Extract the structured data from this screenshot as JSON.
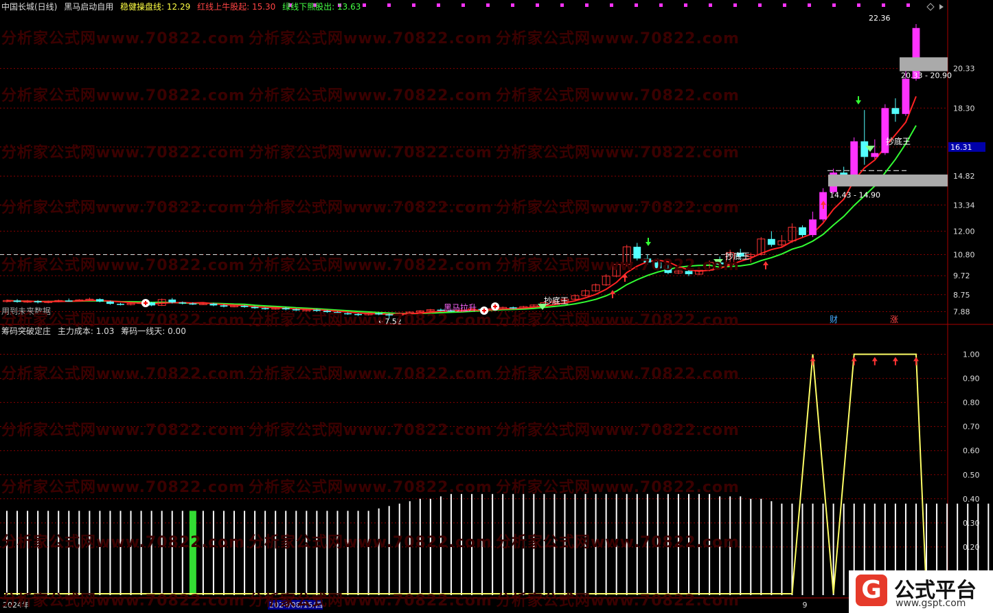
{
  "header": {
    "title": "中国长城(日线)",
    "indicator_name": "黑马启动自用",
    "line1_label": "稳健操盘线: 12.29",
    "line2_label": "红线上牛股起: 15.30",
    "line3_label": "绿线下熊股出: 13.63"
  },
  "sub_header": {
    "indicator_name": "筹码突破定庄",
    "value1": "主力成本: 1.03",
    "value2": "筹码一线天: 0.00"
  },
  "watermark": "分析家公式网www.70822.com",
  "logo": {
    "brand": "公式平台",
    "url": "www.gspt.com",
    "glyph": "G"
  },
  "annotations": {
    "future_data": "用到未来数据",
    "low_price": "←7.52",
    "high_price": "22.36",
    "zone_top": "20.33 - 20.90",
    "zone_bottom": "14.43 - 14.90",
    "bottom_king": "抄底王",
    "black_horse": "黑马拉升",
    "current_price": "16.31",
    "finance_tag": "财",
    "up_tag": "涨"
  },
  "colors": {
    "background": "#000000",
    "up_candle": "#ff3333",
    "down_candle": "#54ffff",
    "magenta": "#ff33ff",
    "red_line": "#ff2222",
    "green_line": "#33ff33",
    "yellow_line": "#ffff66",
    "grid": "#8b0000",
    "axis_text": "#dddddd"
  },
  "chart_data": [
    {
      "type": "candlestick",
      "title": "中国长城(日线)",
      "y_ticks": [
        "20.33",
        "18.30",
        "16.31",
        "14.82",
        "13.34",
        "12.00",
        "10.80",
        "9.72",
        "8.75",
        "7.88"
      ],
      "x_ticks": [
        "2024年",
        "8",
        "2024/08/15/四",
        "9",
        "10"
      ],
      "ylim": [
        7.3,
        23.2
      ],
      "candles": [
        [
          8.4,
          8.45,
          8.5,
          8.35
        ],
        [
          8.45,
          8.38,
          8.52,
          8.34
        ],
        [
          8.38,
          8.42,
          8.48,
          8.33
        ],
        [
          8.42,
          8.36,
          8.47,
          8.3
        ],
        [
          8.36,
          8.4,
          8.45,
          8.31
        ],
        [
          8.4,
          8.45,
          8.5,
          8.36
        ],
        [
          8.45,
          8.43,
          8.55,
          8.39
        ],
        [
          8.43,
          8.48,
          8.52,
          8.4
        ],
        [
          8.48,
          8.52,
          8.6,
          8.44
        ],
        [
          8.52,
          8.4,
          8.56,
          8.36
        ],
        [
          8.4,
          8.28,
          8.44,
          8.24
        ],
        [
          8.28,
          8.24,
          8.33,
          8.2
        ],
        [
          8.24,
          8.3,
          8.35,
          8.2
        ],
        [
          8.3,
          8.35,
          8.4,
          8.26
        ],
        [
          8.35,
          8.2,
          8.38,
          8.16
        ],
        [
          8.2,
          8.5,
          8.55,
          8.17
        ],
        [
          8.5,
          8.35,
          8.58,
          8.3
        ],
        [
          8.35,
          8.3,
          8.4,
          8.25
        ],
        [
          8.3,
          8.26,
          8.36,
          8.22
        ],
        [
          8.26,
          8.29,
          8.34,
          8.22
        ],
        [
          8.29,
          8.2,
          8.33,
          8.16
        ],
        [
          8.2,
          8.14,
          8.25,
          8.1
        ],
        [
          8.14,
          8.18,
          8.22,
          8.1
        ],
        [
          8.18,
          8.12,
          8.22,
          8.08
        ],
        [
          8.12,
          8.06,
          8.16,
          8.02
        ],
        [
          8.06,
          8.02,
          8.1,
          7.98
        ],
        [
          8.02,
          8.06,
          8.1,
          7.98
        ],
        [
          8.06,
          8.0,
          8.12,
          7.95
        ],
        [
          8.0,
          7.96,
          8.04,
          7.92
        ],
        [
          7.96,
          7.98,
          8.03,
          7.92
        ],
        [
          7.98,
          7.92,
          8.02,
          7.88
        ],
        [
          7.92,
          7.86,
          7.96,
          7.82
        ],
        [
          7.86,
          7.8,
          7.9,
          7.76
        ],
        [
          7.8,
          7.76,
          7.84,
          7.72
        ],
        [
          7.76,
          7.72,
          7.8,
          7.66
        ],
        [
          7.72,
          7.8,
          7.85,
          7.68
        ],
        [
          7.8,
          7.74,
          7.84,
          7.7
        ],
        [
          7.74,
          7.7,
          7.78,
          7.52
        ],
        [
          7.7,
          7.8,
          7.84,
          7.66
        ],
        [
          7.8,
          7.86,
          7.9,
          7.76
        ],
        [
          7.86,
          7.92,
          7.96,
          7.82
        ],
        [
          7.92,
          7.98,
          8.02,
          7.88
        ],
        [
          7.98,
          7.94,
          8.04,
          7.9
        ],
        [
          7.94,
          7.9,
          7.98,
          7.86
        ],
        [
          7.9,
          7.96,
          8.0,
          7.86
        ],
        [
          7.96,
          8.02,
          8.06,
          7.92
        ],
        [
          8.02,
          7.98,
          8.06,
          7.94
        ],
        [
          7.98,
          8.04,
          8.08,
          7.94
        ],
        [
          8.04,
          8.1,
          8.14,
          8.0
        ],
        [
          8.1,
          8.06,
          8.14,
          8.02
        ],
        [
          8.06,
          8.14,
          8.18,
          8.02
        ],
        [
          8.14,
          8.22,
          8.26,
          8.1
        ],
        [
          8.22,
          8.34,
          8.38,
          8.18
        ],
        [
          8.34,
          8.42,
          8.48,
          8.3
        ],
        [
          8.42,
          8.52,
          8.58,
          8.38
        ],
        [
          8.52,
          8.7,
          8.76,
          8.48
        ],
        [
          8.7,
          8.95,
          9.02,
          8.66
        ],
        [
          8.95,
          9.25,
          9.32,
          8.9
        ],
        [
          9.25,
          9.7,
          9.8,
          9.2
        ],
        [
          9.7,
          10.3,
          10.4,
          9.64
        ],
        [
          10.3,
          11.2,
          11.3,
          10.2
        ],
        [
          11.2,
          10.6,
          11.4,
          10.5
        ],
        [
          10.6,
          10.4,
          10.8,
          10.3
        ],
        [
          10.4,
          10.1,
          10.6,
          10.0
        ],
        [
          10.1,
          9.86,
          10.3,
          9.8
        ],
        [
          9.86,
          9.96,
          10.1,
          9.8
        ],
        [
          9.96,
          9.8,
          10.1,
          9.7
        ],
        [
          9.8,
          10.0,
          10.16,
          9.74
        ],
        [
          10.0,
          10.4,
          10.5,
          9.94
        ],
        [
          10.4,
          10.3,
          10.7,
          10.2
        ],
        [
          10.3,
          10.9,
          11.05,
          10.25
        ],
        [
          10.9,
          10.7,
          11.1,
          10.6
        ],
        [
          10.7,
          10.8,
          10.9,
          10.4
        ],
        [
          10.8,
          11.6,
          11.7,
          10.75
        ],
        [
          11.6,
          11.3,
          12.0,
          11.2
        ],
        [
          11.3,
          11.5,
          11.8,
          11.2
        ],
        [
          11.5,
          12.2,
          12.4,
          11.4
        ],
        [
          12.2,
          11.8,
          12.3,
          11.7
        ],
        [
          11.8,
          12.6,
          13.0,
          11.7
        ],
        [
          12.6,
          14.0,
          14.2,
          12.5
        ],
        [
          14.0,
          15.0,
          15.2,
          13.9
        ],
        [
          15.0,
          14.8,
          15.3,
          14.6
        ],
        [
          14.8,
          16.6,
          16.8,
          14.7
        ],
        [
          16.6,
          15.8,
          18.2,
          15.4
        ],
        [
          15.8,
          16.0,
          16.7,
          15.7
        ],
        [
          16.0,
          18.3,
          18.5,
          15.9
        ],
        [
          18.3,
          18.0,
          18.8,
          17.6
        ],
        [
          18.0,
          19.8,
          20.2,
          17.9
        ],
        [
          19.8,
          22.4,
          22.6,
          19.7
        ]
      ]
    },
    {
      "type": "bar",
      "title": "筹码突破定庄",
      "y_ticks": [
        "1.00",
        "0.90",
        "0.80",
        "0.70",
        "0.60",
        "0.50",
        "0.40",
        "0.30",
        "0.20"
      ],
      "ylim": [
        0.0,
        1.05
      ],
      "values": [
        0.35,
        0.35,
        0.35,
        0.35,
        0.35,
        0.35,
        0.35,
        0.35,
        0.35,
        0.35,
        0.35,
        0.35,
        0.35,
        0.35,
        0.35,
        0.35,
        0.35,
        0.35,
        0.35,
        0.35,
        0.35,
        0.35,
        0.35,
        0.35,
        0.35,
        0.35,
        0.35,
        0.35,
        0.35,
        0.35,
        0.35,
        0.35,
        0.35,
        0.35,
        0.35,
        0.35,
        0.36,
        0.37,
        0.38,
        0.39,
        0.4,
        0.4,
        0.41,
        0.42,
        0.42,
        0.42,
        0.42,
        0.42,
        0.42,
        0.42,
        0.42,
        0.42,
        0.42,
        0.42,
        0.42,
        0.42,
        0.42,
        0.42,
        0.42,
        0.42,
        0.42,
        0.42,
        0.42,
        0.42,
        0.42,
        0.42,
        0.42,
        0.42,
        0.42,
        0.41,
        0.41,
        0.41,
        0.4,
        0.4,
        0.39,
        0.38,
        0.38,
        0.38,
        0.38,
        0.38,
        0.38,
        0.38,
        0.38,
        0.38,
        0.38,
        0.38,
        0.38,
        0.38,
        0.38,
        0.38,
        0.38,
        0.38,
        0.38,
        0.38,
        0.38,
        0.38,
        0.38,
        0.38,
        0.38,
        0.38,
        0.38,
        0.38,
        0.38,
        0.38,
        0.38,
        0.37,
        0.37,
        0.37,
        0.37,
        0.37,
        0.41,
        0.42,
        0.42,
        0.49,
        0.54,
        0.85,
        0.93,
        0.94,
        0.87,
        0.85,
        1.03
      ]
    }
  ]
}
